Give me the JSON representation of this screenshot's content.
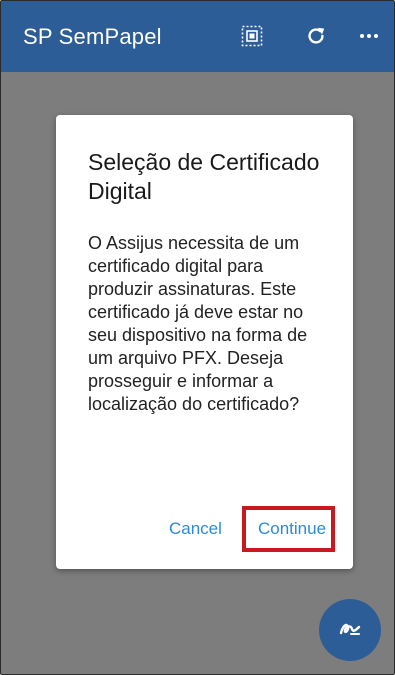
{
  "app_bar": {
    "title": "SP SemPapel",
    "icons": [
      "scan-icon",
      "refresh-icon",
      "more-icon"
    ],
    "color": "#2c5d96"
  },
  "dialog": {
    "title": "Seleção de Certificado Digital",
    "message": "O Assijus necessita de um certificado digital para produzir assinaturas. Este certificado já deve estar no seu dispositivo na forma de um arquivo PFX. Deseja prosseguir e informar a localização do certificado?",
    "cancel_label": "Cancel",
    "continue_label": "Continue",
    "button_color": "#2f8ad6"
  },
  "fab": {
    "icon": "signature-icon"
  },
  "highlight": {
    "target": "continue-button",
    "color": "#c8191e"
  }
}
